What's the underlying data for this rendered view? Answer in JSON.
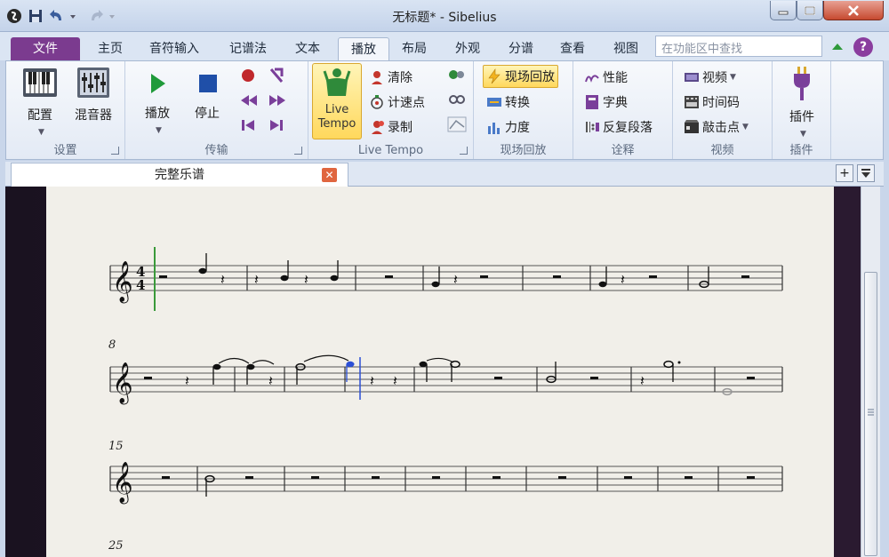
{
  "app": {
    "title": "无标题* - Sibelius"
  },
  "tabs": [
    "主页",
    "音符输入",
    "记谱法",
    "文本",
    "播放",
    "布局",
    "外观",
    "分谱",
    "查看",
    "视图"
  ],
  "file_tab": "文件",
  "search": {
    "placeholder": "在功能区中查找"
  },
  "ribbon": {
    "setup": {
      "label": "设置",
      "config": "配置",
      "mixer": "混音器"
    },
    "transport": {
      "label": "传输",
      "play": "播放",
      "stop": "停止"
    },
    "live_tempo": {
      "label": "Live Tempo",
      "big_line1": "Live",
      "big_line2": "Tempo",
      "clear": "清除",
      "tap_points": "计速点",
      "record": "录制"
    },
    "live_playback": {
      "label": "现场回放",
      "live_playback": "现场回放",
      "convert": "转换",
      "velocity": "力度"
    },
    "interpretation": {
      "label": "诠释",
      "performance": "性能",
      "dictionary": "字典",
      "repeats": "反复段落"
    },
    "video": {
      "label": "视频",
      "video": "视频",
      "timecode": "时间码",
      "hit_points": "敲击点"
    },
    "plugins": {
      "label": "插件",
      "plugins": "插件"
    }
  },
  "document": {
    "tab_label": "完整乐谱"
  },
  "score": {
    "systems": [
      "8",
      "15",
      "25"
    ]
  },
  "colors": {
    "file_tab": "#7b3b8f",
    "highlight": "#ffd85c",
    "cursor": "#2b4fd6",
    "playline": "#3a9a3a"
  }
}
